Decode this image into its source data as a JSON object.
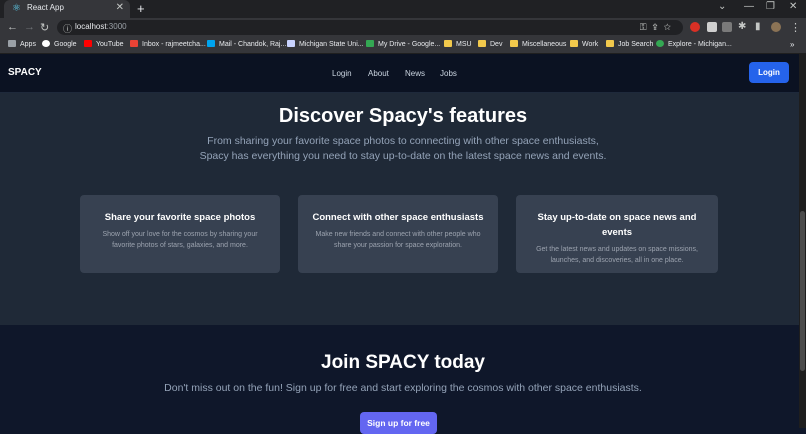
{
  "browser": {
    "tab_title": "React App",
    "new_tab": "+",
    "url_host": "localhost",
    "url_port": ":3000",
    "bookmarks": [
      {
        "label": "Apps"
      },
      {
        "label": "Google"
      },
      {
        "label": "YouTube"
      },
      {
        "label": "Inbox - rajmeetcha..."
      },
      {
        "label": "Mail - Chandok, Raj..."
      },
      {
        "label": "Michigan State Uni..."
      },
      {
        "label": "My Drive - Google..."
      },
      {
        "label": "MSU"
      },
      {
        "label": "Dev"
      },
      {
        "label": "Miscellaneous"
      },
      {
        "label": "Work"
      },
      {
        "label": "Job Search"
      },
      {
        "label": "Explore - Michigan..."
      }
    ]
  },
  "nav": {
    "brand": "SPACY",
    "links": [
      "Login",
      "About",
      "News",
      "Jobs"
    ],
    "login_button": "Login"
  },
  "features": {
    "title": "Discover Spacy's features",
    "lead_line1": "From sharing your favorite space photos to connecting with other space enthusiasts,",
    "lead_line2": "Spacy has everything you need to stay up-to-date on the latest space news and events.",
    "cards": [
      {
        "title": "Share your favorite space photos",
        "desc1": "Show off your love for the cosmos by sharing your",
        "desc2": "favorite photos of stars, galaxies, and more."
      },
      {
        "title": "Connect with other space enthusiasts",
        "desc1": "Make new friends and connect with other people who",
        "desc2": "share your passion for space exploration."
      },
      {
        "title1": "Stay up-to-date on space news and",
        "title2": "events",
        "desc1": "Get the latest news and updates on space missions,",
        "desc2": "launches, and discoveries, all in one place."
      }
    ]
  },
  "join": {
    "title": "Join SPACY today",
    "text": "Don't miss out on the fun! Sign up for free and start exploring the cosmos with other space enthusiasts.",
    "button": "Sign up for free"
  }
}
